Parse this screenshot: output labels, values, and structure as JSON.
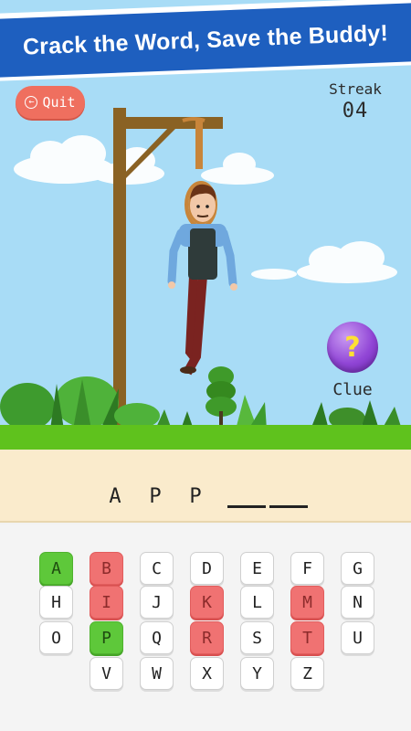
{
  "header": {
    "banner_text": "Crack the Word, Save the Buddy!"
  },
  "quit_button": {
    "label": "Quit",
    "icon": "back-arrow-circle-icon"
  },
  "streak": {
    "label": "Streak",
    "value": "04"
  },
  "clue": {
    "label": "Clue",
    "icon_glyph": "?"
  },
  "word": {
    "revealed_letters": [
      "A",
      "P",
      "P"
    ],
    "blank_count": 2
  },
  "keyboard": {
    "rows": [
      [
        {
          "letter": "A",
          "state": "correct"
        },
        {
          "letter": "B",
          "state": "wrong"
        },
        {
          "letter": "C",
          "state": "unused"
        },
        {
          "letter": "D",
          "state": "unused"
        },
        {
          "letter": "E",
          "state": "unused"
        },
        {
          "letter": "F",
          "state": "unused"
        },
        {
          "letter": "G",
          "state": "unused"
        }
      ],
      [
        {
          "letter": "H",
          "state": "unused"
        },
        {
          "letter": "I",
          "state": "wrong"
        },
        {
          "letter": "J",
          "state": "unused"
        },
        {
          "letter": "K",
          "state": "wrong"
        },
        {
          "letter": "L",
          "state": "unused"
        },
        {
          "letter": "M",
          "state": "wrong"
        },
        {
          "letter": "N",
          "state": "unused"
        }
      ],
      [
        {
          "letter": "O",
          "state": "unused"
        },
        {
          "letter": "P",
          "state": "correct"
        },
        {
          "letter": "Q",
          "state": "unused"
        },
        {
          "letter": "R",
          "state": "wrong"
        },
        {
          "letter": "S",
          "state": "unused"
        },
        {
          "letter": "T",
          "state": "wrong"
        },
        {
          "letter": "U",
          "state": "unused"
        }
      ],
      [
        {
          "letter": "V",
          "state": "unused"
        },
        {
          "letter": "W",
          "state": "unused"
        },
        {
          "letter": "X",
          "state": "unused"
        },
        {
          "letter": "Y",
          "state": "unused"
        },
        {
          "letter": "Z",
          "state": "unused"
        }
      ]
    ]
  },
  "colors": {
    "banner": "#1e5fbf",
    "quit": "#ef6f5f",
    "correct": "#5ec83a",
    "wrong": "#f07272",
    "sky": "#a8dcf6",
    "grass": "#5fc21d"
  }
}
